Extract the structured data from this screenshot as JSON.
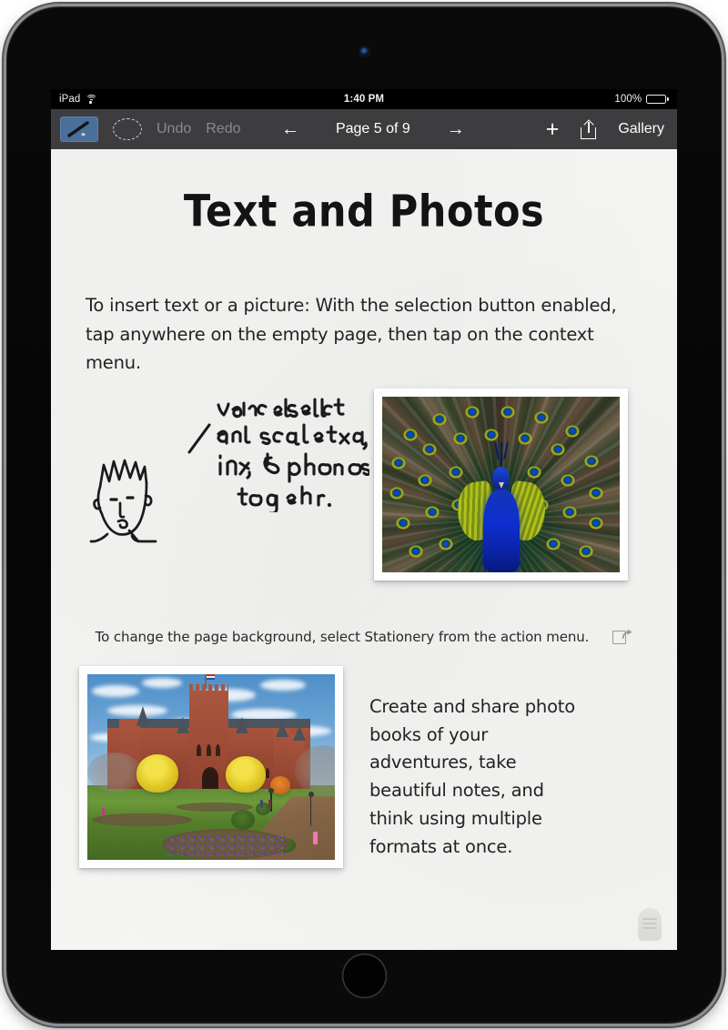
{
  "device": {
    "type": "ipad",
    "camera_label": "front-camera",
    "home_button_label": "home-button"
  },
  "status_bar": {
    "carrier": "iPad",
    "wifi_icon": "wifi-icon",
    "time": "1:40 PM",
    "battery_percent": "100%",
    "battery_icon": "battery-full-icon"
  },
  "toolbar": {
    "pen_tool": {
      "name": "pen-tool",
      "icon": "pen-icon",
      "selected": true,
      "accent": "#4a6f9a"
    },
    "lasso_tool": {
      "name": "lasso-select-tool",
      "icon": "dashed-ellipse-icon",
      "selected": false
    },
    "undo_label": "Undo",
    "redo_label": "Redo",
    "undo_enabled": false,
    "redo_enabled": false,
    "prev_arrow": "←",
    "next_arrow": "→",
    "page_indicator": "Page 5 of 9",
    "current_page": 5,
    "total_pages": 9,
    "add_label": "+",
    "add_icon": "plus-icon",
    "share_icon": "share-upload-icon",
    "gallery_label": "Gallery",
    "background": "#3d3d3f",
    "text_color": "#ffffff",
    "disabled_color": "#8a8a8c"
  },
  "page": {
    "background": "#f5f5f3",
    "title": "Text and Photos",
    "intro_text": "To insert text or a picture: With the selection button enabled, tap anywhere on the empty page, then tap on the context menu.",
    "ink_note": {
      "name": "handwritten-ink-note",
      "lines": [
        "You can select",
        "and scale text,",
        "ink, & photos",
        "together."
      ],
      "full_text": "You can select and scale text, ink, & photos together.",
      "color": "#1b1b1b"
    },
    "doodle": {
      "name": "face-doodle",
      "description": "hand-drawn sketch of a person's head with spiky hair"
    },
    "peacock_photo": {
      "name": "peacock-photo",
      "description": "peacock with fully fanned iridescent tail feathers",
      "body_color": "#0f2fd0",
      "wing_color": "#b8c41c"
    },
    "stationery_text": "To change the page background, select Stationery from the action menu.",
    "stationery_action_icon": "share-action-icon",
    "castle_photo": {
      "name": "castle-photo",
      "description": "red sandstone castle building with towers, yellow autumn trees and a green lawn",
      "building_color": "#9a4a35",
      "tree_color": "#e2c927",
      "sky_color": "#6fa7d6"
    },
    "outro_text": "Create and share photo books of your adventures, take beautiful notes, and think using multiple formats at once.",
    "page_curl_icon": "page-curl-handle"
  }
}
